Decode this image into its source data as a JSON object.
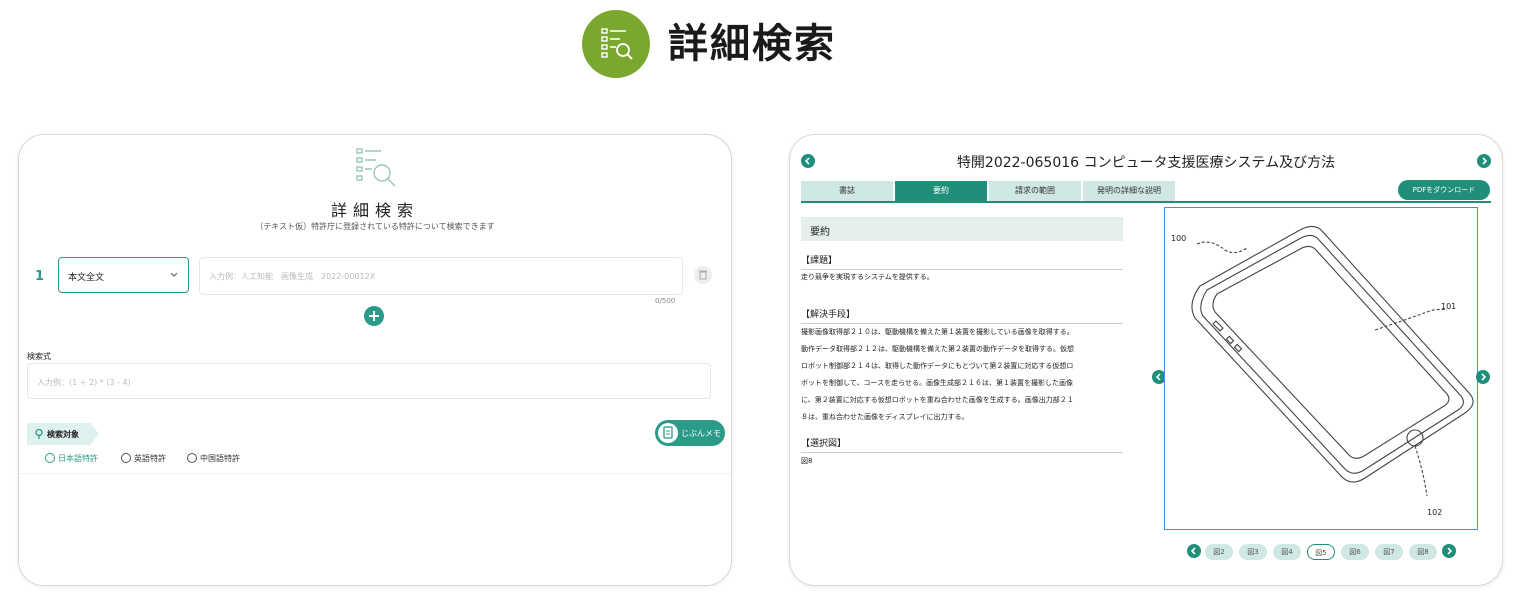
{
  "header": {
    "title": "詳細検索",
    "icon": "search-list-icon"
  },
  "search_panel": {
    "title": "詳細検索",
    "subtitle": "（テキスト仮）特許庁に登録されている特許について検索できます",
    "row_number": "1",
    "field_select": "本文全文",
    "keyword_placeholder": "入力例：人工知能　画像生成　2022-00012X",
    "counter": "0/500",
    "expression_label": "検索式",
    "expression_placeholder": "入力例：(1 + 2) * (3 - 4)",
    "target_label": "検索対象",
    "memo_label": "じぶんメモ",
    "targets": [
      {
        "label": "日本語特許",
        "selected": true
      },
      {
        "label": "英語特許",
        "selected": false
      },
      {
        "label": "中国語特許",
        "selected": false
      }
    ]
  },
  "document": {
    "title": "特開2022-065016 コンピュータ支援医療システム及び方法",
    "tabs": [
      "書誌",
      "要約",
      "請求の範囲",
      "発明の詳細な説明"
    ],
    "active_tab": "要約",
    "pdf_button": "PDFをダウンロード",
    "section_title": "要約",
    "problem_heading": "【課題】",
    "problem_text": "走り競争を実現するシステムを提供する。",
    "solution_heading": "【解決手段】",
    "solution_lines": [
      "撮影画像取得部２１０は、駆動機構を備えた第１装置を撮影している画像を取得する。",
      "動作データ取得部２１２は、駆動機構を備えた第２装置の動作データを取得する。仮想",
      "ロボット制御部２１４は、取得した動作データにもとづいて第２装置に対応する仮想ロ",
      "ボットを制御して、コースを走らせる。画像生成部２１６は、第１装置を撮影した画像",
      "に、第２装置に対応する仮想ロボットを重ね合わせた画像を生成する。画像出力部２１",
      "８は、重ね合わせた画像をディスプレイに出力する。"
    ],
    "selection_heading": "【選択図】",
    "selection_text": "図8",
    "figure_labels": {
      "device": "100",
      "screen": "101",
      "button": "102"
    },
    "pages": [
      "図2",
      "図3",
      "図4",
      "図5",
      "図6",
      "図7",
      "図8"
    ],
    "active_page": "図5"
  },
  "colors": {
    "accent": "#1f8f79",
    "brand_green": "#7aa72e",
    "tab_inactive": "#cfe8e4"
  }
}
